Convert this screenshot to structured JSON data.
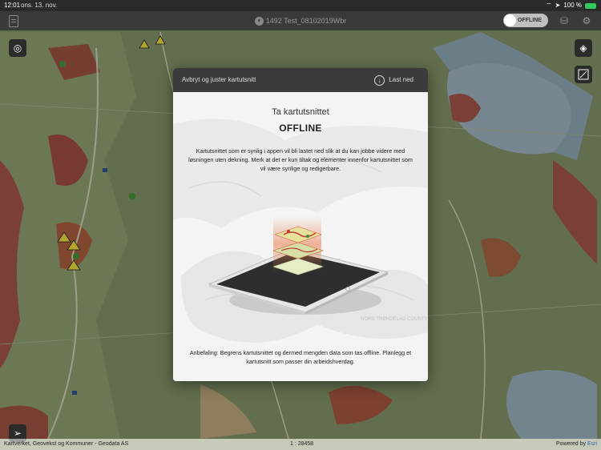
{
  "status_bar": {
    "time": "12:01",
    "date": "ons. 13. nov.",
    "battery": "100 %"
  },
  "navbar": {
    "title": "1492 Test_08102019Wbr",
    "offline_toggle_label": "OFFLINE"
  },
  "modal": {
    "header_left": "Avbryt og juster kartutsnitt",
    "header_right": "Last ned",
    "title": "Ta kartutsnittet",
    "subtitle": "OFFLINE",
    "description": "Kartutsnittet som er synlig i appen vil bli lastet ned slik at du kan jobbe videre med løsningen uten dekning. Merk at det er kun tiltak og elementer innenfor kartutsnittet som vil være synlige og redigerbare.",
    "recommendation": "Anbefaling: Begrens kartutsnittet og dermed mengden data som tas offline. Planlegg et kartutsnitt som passer din arbeidshverdag.",
    "background_map_label": "NORD TRØNDELAG COUNTY"
  },
  "attribution": {
    "credits": "Kartverket, Geovekst og Kommuner - Geodata AS",
    "scale": "1 : 28458",
    "powered_prefix": "Powered by ",
    "powered_by": "Esri"
  },
  "icons": {
    "nav_left": "document-icon",
    "basemap": "basemap-icon",
    "layers": "layers-icon",
    "extent": "extent-icon",
    "locate": "locate-arrow-icon",
    "settings": "gear-icon",
    "sync": "database-sync-icon"
  },
  "colors": {
    "accent_green": "#34c759",
    "header_dark": "#3b3b3b"
  }
}
